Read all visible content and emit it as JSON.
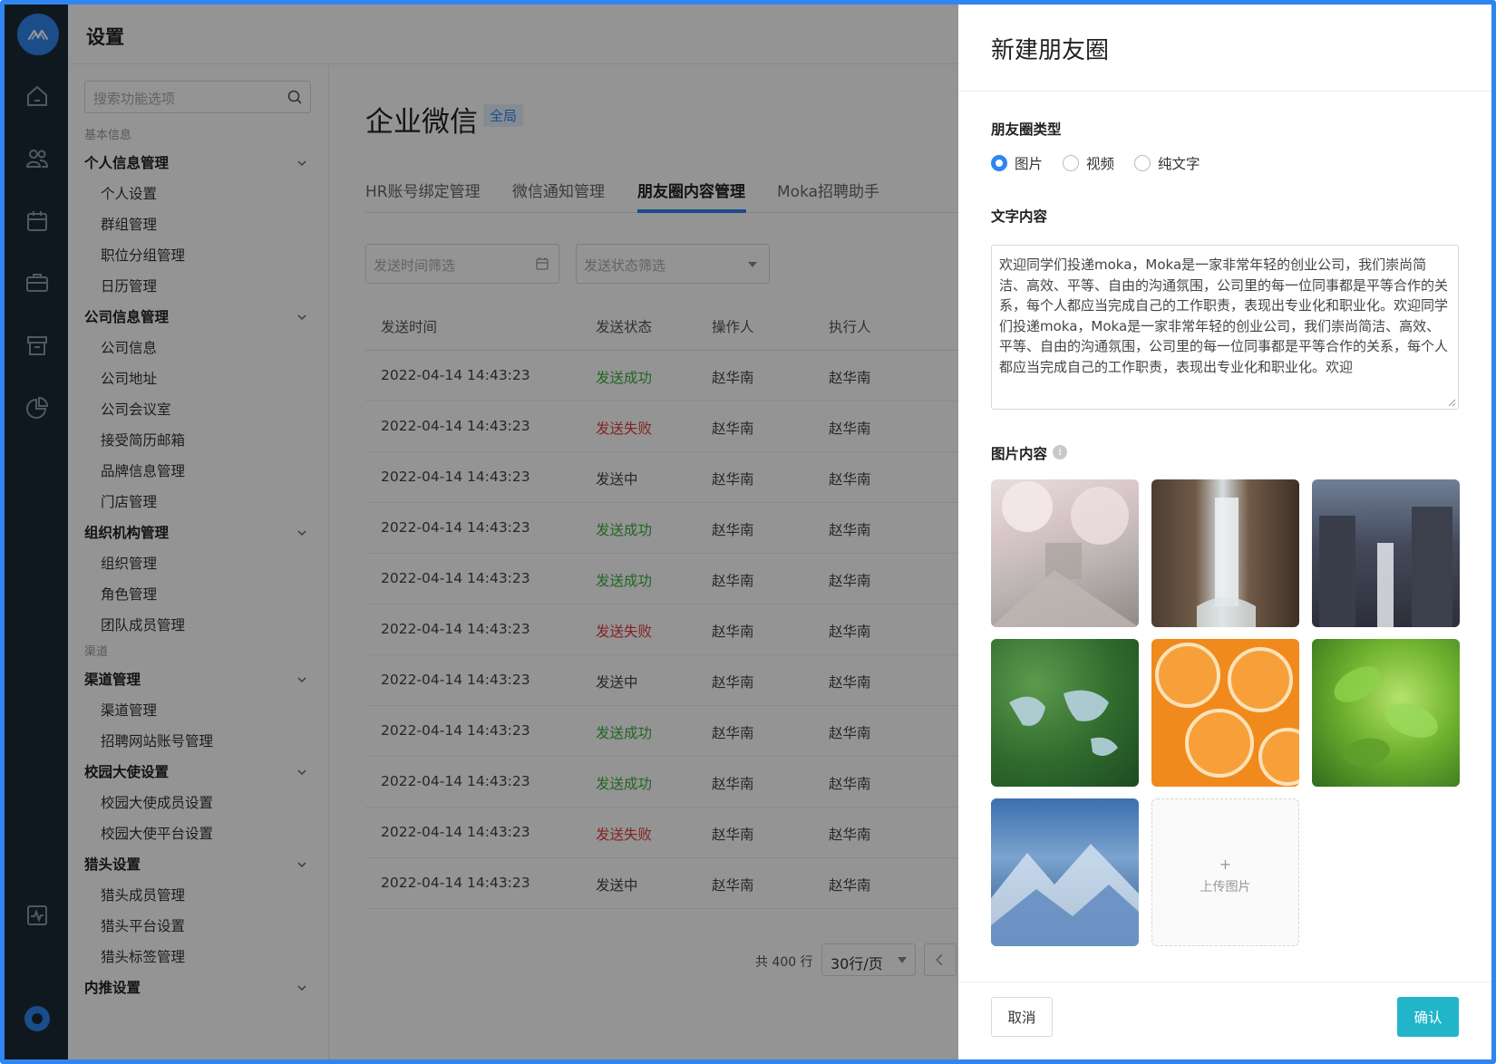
{
  "topbar": {
    "title": "设置"
  },
  "search": {
    "placeholder": "搜索功能选项"
  },
  "menu": {
    "sections": [
      {
        "label": "基本信息"
      },
      {
        "label": "渠道"
      }
    ],
    "groups": [
      {
        "label": "个人信息管理",
        "items": [
          "个人设置",
          "群组管理",
          "职位分组管理",
          "日历管理"
        ]
      },
      {
        "label": "公司信息管理",
        "items": [
          "公司信息",
          "公司地址",
          "公司会议室",
          "接受简历邮箱",
          "品牌信息管理",
          "门店管理"
        ]
      },
      {
        "label": "组织机构管理",
        "items": [
          "组织管理",
          "角色管理",
          "团队成员管理"
        ]
      },
      {
        "label": "渠道管理",
        "items": [
          "渠道管理",
          "招聘网站账号管理"
        ]
      },
      {
        "label": "校园大使设置",
        "items": [
          "校园大使成员设置",
          "校园大使平台设置"
        ]
      },
      {
        "label": "猎头设置",
        "items": [
          "猎头成员管理",
          "猎头平台设置",
          "猎头标签管理"
        ]
      },
      {
        "label": "内推设置",
        "items": []
      }
    ]
  },
  "main": {
    "title": "企业微信",
    "badge": "全局",
    "tabs": [
      "HR账号绑定管理",
      "微信通知管理",
      "朋友圈内容管理",
      "Moka招聘助手"
    ],
    "active_tab": 2,
    "filters": {
      "time_placeholder": "发送时间筛选",
      "status_placeholder": "发送状态筛选"
    },
    "columns": [
      "发送时间",
      "发送状态",
      "操作人",
      "执行人"
    ],
    "rows": [
      {
        "time": "2022-04-14  14:43:23",
        "status": "发送成功",
        "kind": "ok",
        "operator": "赵华南",
        "executor": "赵华南"
      },
      {
        "time": "2022-04-14  14:43:23",
        "status": "发送失败",
        "kind": "fail",
        "operator": "赵华南",
        "executor": "赵华南"
      },
      {
        "time": "2022-04-14  14:43:23",
        "status": "发送中",
        "kind": "pending",
        "operator": "赵华南",
        "executor": "赵华南"
      },
      {
        "time": "2022-04-14  14:43:23",
        "status": "发送成功",
        "kind": "ok",
        "operator": "赵华南",
        "executor": "赵华南"
      },
      {
        "time": "2022-04-14  14:43:23",
        "status": "发送成功",
        "kind": "ok",
        "operator": "赵华南",
        "executor": "赵华南"
      },
      {
        "time": "2022-04-14  14:43:23",
        "status": "发送失败",
        "kind": "fail",
        "operator": "赵华南",
        "executor": "赵华南"
      },
      {
        "time": "2022-04-14  14:43:23",
        "status": "发送中",
        "kind": "pending",
        "operator": "赵华南",
        "executor": "赵华南"
      },
      {
        "time": "2022-04-14  14:43:23",
        "status": "发送成功",
        "kind": "ok",
        "operator": "赵华南",
        "executor": "赵华南"
      },
      {
        "time": "2022-04-14  14:43:23",
        "status": "发送成功",
        "kind": "ok",
        "operator": "赵华南",
        "executor": "赵华南"
      },
      {
        "time": "2022-04-14  14:43:23",
        "status": "发送失败",
        "kind": "fail",
        "operator": "赵华南",
        "executor": "赵华南"
      },
      {
        "time": "2022-04-14  14:43:23",
        "status": "发送中",
        "kind": "pending",
        "operator": "赵华南",
        "executor": "赵华南"
      }
    ],
    "pager": {
      "total": "共 400 行",
      "page_size": "30行/页"
    }
  },
  "drawer": {
    "title": "新建朋友圈",
    "type_label": "朋友圈类型",
    "type_options": [
      "图片",
      "视频",
      "纯文字"
    ],
    "type_selected": 0,
    "text_label": "文字内容",
    "text_value": "欢迎同学们投递moka，Moka是一家非常年轻的创业公司，我们崇尚简洁、高效、平等、自由的沟通氛围，公司里的每一位同事都是平等合作的关系，每个人都应当完成自己的工作职责，表现出专业化和职业化。欢迎同学们投递moka，Moka是一家非常年轻的创业公司，我们崇尚简洁、高效、平等、自由的沟通氛围，公司里的每一位同事都是平等合作的关系，每个人都应当完成自己的工作职责，表现出专业化和职业化。欢迎",
    "image_label": "图片内容",
    "upload_plus": "+",
    "upload_label": "上传图片",
    "cancel": "取消",
    "confirm": "确认"
  },
  "colors": {
    "accent": "#2f86f0",
    "success": "#3cae3c",
    "fail": "#e33b3b",
    "confirm_button": "#22b5c9",
    "rail": "#1c2a36"
  },
  "icons": {
    "rail": [
      "home-icon",
      "users-icon",
      "calendar-icon",
      "briefcase-icon",
      "archive-icon",
      "pie-chart-icon",
      "activity-icon",
      "settings-icon"
    ]
  }
}
